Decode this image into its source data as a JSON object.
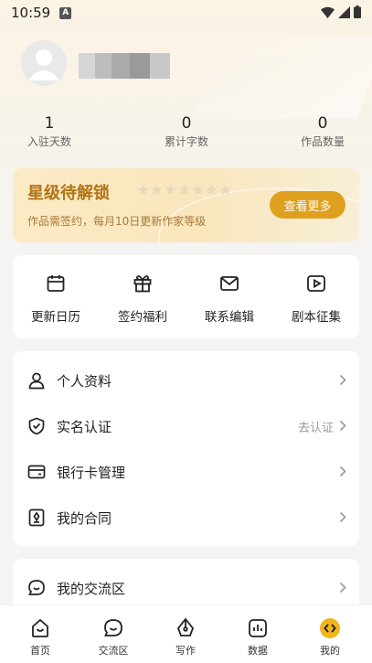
{
  "status_bar": {
    "time": "10:59",
    "notification_badge": "A"
  },
  "profile": {
    "username_blurred": true
  },
  "stats": [
    {
      "value": "1",
      "label": "入驻天数"
    },
    {
      "value": "0",
      "label": "累计字数"
    },
    {
      "value": "0",
      "label": "作品数量"
    }
  ],
  "banner": {
    "title": "星级待解锁",
    "stars": 7,
    "subtitle": "作品需签约，每月10日更新作家等级",
    "button": "查看更多",
    "accent_color": "#dea01e"
  },
  "quick_actions": [
    {
      "label": "更新日历",
      "icon": "calendar-icon"
    },
    {
      "label": "签约福利",
      "icon": "gift-icon"
    },
    {
      "label": "联系编辑",
      "icon": "mail-icon"
    },
    {
      "label": "剧本征集",
      "icon": "play-icon"
    }
  ],
  "menu": [
    {
      "label": "个人资料",
      "icon": "person-icon",
      "right": ""
    },
    {
      "label": "实名认证",
      "icon": "shield-check-icon",
      "right": "去认证"
    },
    {
      "label": "银行卡管理",
      "icon": "card-icon",
      "right": ""
    },
    {
      "label": "我的合同",
      "icon": "contract-icon",
      "right": ""
    }
  ],
  "community": {
    "label": "我的交流区",
    "icon": "chat-icon"
  },
  "bottom_nav": [
    {
      "label": "首页",
      "icon": "home-icon",
      "active": false
    },
    {
      "label": "交流区",
      "icon": "chat-bubble-icon",
      "active": false
    },
    {
      "label": "写作",
      "icon": "pen-icon",
      "active": false
    },
    {
      "label": "数据",
      "icon": "chart-icon",
      "active": false
    },
    {
      "label": "我的",
      "icon": "profile-icon",
      "active": true
    }
  ]
}
